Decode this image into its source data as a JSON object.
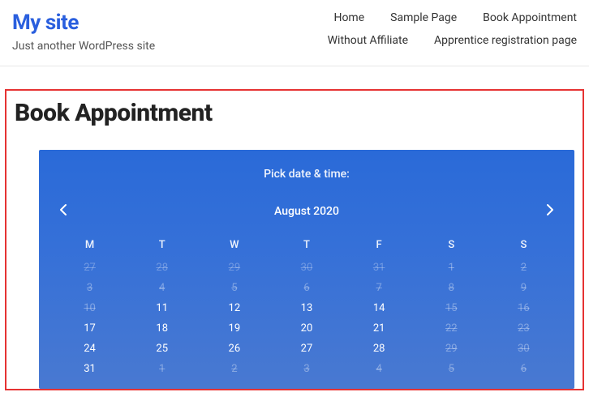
{
  "header": {
    "site_title": "My site",
    "tagline": "Just another WordPress site",
    "nav_rows": [
      [
        "Home",
        "Sample Page",
        "Book Appointment"
      ],
      [
        "Without Affiliate",
        "Apprentice registration page"
      ]
    ]
  },
  "page": {
    "heading": "Book Appointment"
  },
  "calendar": {
    "prompt": "Pick date & time:",
    "month_label": "August 2020",
    "dow": [
      "M",
      "T",
      "W",
      "T",
      "F",
      "S",
      "S"
    ],
    "cells": [
      {
        "n": "27",
        "s": "out"
      },
      {
        "n": "28",
        "s": "out"
      },
      {
        "n": "29",
        "s": "out"
      },
      {
        "n": "30",
        "s": "out"
      },
      {
        "n": "31",
        "s": "out"
      },
      {
        "n": "1",
        "s": "disabled"
      },
      {
        "n": "2",
        "s": "disabled"
      },
      {
        "n": "3",
        "s": "disabled"
      },
      {
        "n": "4",
        "s": "disabled"
      },
      {
        "n": "5",
        "s": "disabled"
      },
      {
        "n": "6",
        "s": "disabled"
      },
      {
        "n": "7",
        "s": "disabled"
      },
      {
        "n": "8",
        "s": "disabled"
      },
      {
        "n": "9",
        "s": "disabled"
      },
      {
        "n": "10",
        "s": "disabled"
      },
      {
        "n": "11",
        "s": "in"
      },
      {
        "n": "12",
        "s": "in"
      },
      {
        "n": "13",
        "s": "in"
      },
      {
        "n": "14",
        "s": "in"
      },
      {
        "n": "15",
        "s": "disabled"
      },
      {
        "n": "16",
        "s": "disabled"
      },
      {
        "n": "17",
        "s": "in"
      },
      {
        "n": "18",
        "s": "in"
      },
      {
        "n": "19",
        "s": "in"
      },
      {
        "n": "20",
        "s": "in"
      },
      {
        "n": "21",
        "s": "in"
      },
      {
        "n": "22",
        "s": "disabled"
      },
      {
        "n": "23",
        "s": "disabled"
      },
      {
        "n": "24",
        "s": "in"
      },
      {
        "n": "25",
        "s": "in"
      },
      {
        "n": "26",
        "s": "in"
      },
      {
        "n": "27",
        "s": "in"
      },
      {
        "n": "28",
        "s": "in"
      },
      {
        "n": "29",
        "s": "disabled"
      },
      {
        "n": "30",
        "s": "disabled"
      },
      {
        "n": "31",
        "s": "in"
      },
      {
        "n": "1",
        "s": "disabled"
      },
      {
        "n": "2",
        "s": "disabled"
      },
      {
        "n": "3",
        "s": "disabled"
      },
      {
        "n": "4",
        "s": "disabled"
      },
      {
        "n": "5",
        "s": "disabled"
      },
      {
        "n": "6",
        "s": "disabled"
      }
    ]
  }
}
